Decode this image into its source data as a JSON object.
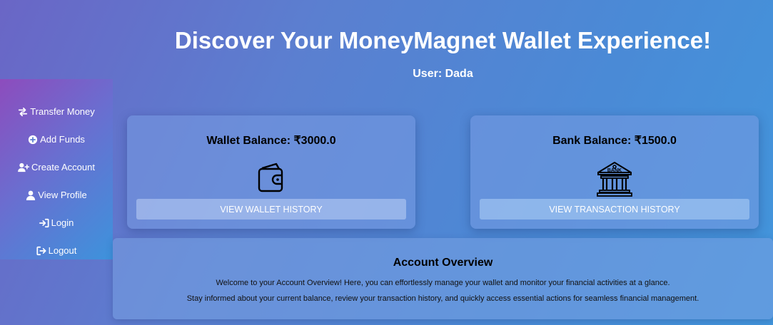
{
  "header": {
    "title": "Discover Your MoneyMagnet Wallet Experience!",
    "user_line": "User: Dada"
  },
  "sidebar": {
    "items": [
      {
        "label": "Transfer Money",
        "icon": "exchange-arrows-icon"
      },
      {
        "label": "Add Funds",
        "icon": "plus-circle-icon"
      },
      {
        "label": "Create Account",
        "icon": "user-plus-icon"
      },
      {
        "label": "View Profile",
        "icon": "user-icon"
      },
      {
        "label": "Login",
        "icon": "sign-in-icon"
      },
      {
        "label": "Logout",
        "icon": "sign-out-icon"
      }
    ]
  },
  "wallet_card": {
    "title": "Wallet Balance: ₹3000.0",
    "icon": "wallet-icon",
    "button_label": "VIEW WALLET HISTORY"
  },
  "bank_card": {
    "title": "Bank Balance: ₹1500.0",
    "icon": "bank-icon",
    "icon_text": "BANK",
    "button_label": "VIEW TRANSACTION HISTORY"
  },
  "overview": {
    "title": "Account Overview",
    "paragraph1": "Welcome to your Account Overview! Here, you can effortlessly manage your wallet and monitor your financial activities at a glance.",
    "paragraph2": "Stay informed about your current balance, review your transaction history, and quickly access essential actions for seamless financial management."
  },
  "colors": {
    "sidebar_gradient_start": "#8d4cbd",
    "sidebar_gradient_end": "#3d93dc",
    "background_start": "#6a66c6",
    "background_end": "#4296dc",
    "heading_text": "#ffffff",
    "card_text": "#000000"
  }
}
